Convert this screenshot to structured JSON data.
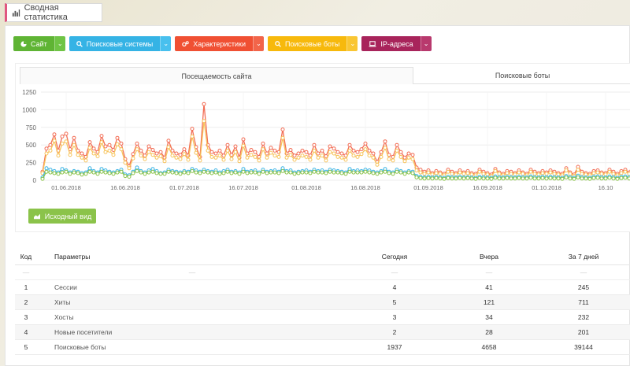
{
  "page": {
    "title": "Сводная статистика"
  },
  "toolbar": {
    "buttons": [
      {
        "label": "Сайт",
        "icon": "pie-chart-icon",
        "color": "#5fb434"
      },
      {
        "label": "Поисковые системы",
        "icon": "search-icon",
        "color": "#35b3e5"
      },
      {
        "label": "Характеристики",
        "icon": "gears-icon",
        "color": "#f05033"
      },
      {
        "label": "Поисковые боты",
        "icon": "search-icon",
        "color": "#f7b90c"
      },
      {
        "label": "IP-адреса",
        "icon": "laptop-icon",
        "color": "#a8245b"
      }
    ]
  },
  "chart": {
    "tabs": [
      "Посещаемость сайта",
      "Поисковые боты"
    ],
    "reset_label": "Исходный вид"
  },
  "chart_data": {
    "type": "line",
    "ylim": [
      0,
      1250
    ],
    "y_ticks": [
      "0",
      "250",
      "500",
      "750",
      "1000",
      "1250"
    ],
    "x_ticks": [
      "01.06.2018",
      "16.06.2018",
      "01.07.2018",
      "16.07.2018",
      "01.08.2018",
      "16.08.2018",
      "01.09.2018",
      "16.09.2018",
      "01.10.2018",
      "16.10"
    ],
    "x_tick_days": [
      6,
      21,
      36,
      51,
      67,
      82,
      98,
      113,
      128,
      143
    ],
    "series": [
      {
        "color": "#f26d55",
        "values": [
          120,
          450,
          500,
          650,
          420,
          620,
          660,
          440,
          600,
          420,
          380,
          330,
          540,
          450,
          400,
          630,
          480,
          500,
          430,
          600,
          520,
          300,
          200,
          370,
          520,
          420,
          350,
          480,
          430,
          380,
          400,
          320,
          560,
          420,
          380,
          360,
          440,
          350,
          730,
          470,
          330,
          1080,
          500,
          400,
          380,
          420,
          350,
          500,
          360,
          480,
          320,
          580,
          380,
          430,
          400,
          330,
          520,
          380,
          460,
          420,
          400,
          720,
          380,
          430,
          350,
          380,
          420,
          400,
          350,
          500,
          380,
          420,
          340,
          480,
          450,
          400,
          380,
          350,
          500,
          420,
          400,
          440,
          520,
          420,
          380,
          260,
          400,
          550,
          360,
          330,
          500,
          400,
          320,
          380,
          360,
          180,
          150,
          120,
          140,
          100,
          130,
          110,
          90,
          150,
          120,
          100,
          140,
          110,
          130,
          100,
          90,
          150,
          120,
          100,
          80,
          160,
          110,
          90,
          130,
          120,
          100,
          140,
          110,
          90,
          150,
          120,
          100,
          130,
          110,
          140,
          120,
          100,
          90,
          170,
          110,
          80,
          190,
          120,
          100,
          90,
          130,
          140,
          110,
          100,
          150,
          120,
          90,
          130,
          150,
          110,
          240
        ],
        "x_start": 0
      },
      {
        "color": "#f7c35a",
        "values": [
          100,
          380,
          420,
          560,
          350,
          520,
          550,
          360,
          500,
          360,
          320,
          280,
          460,
          380,
          340,
          540,
          400,
          420,
          360,
          510,
          440,
          250,
          170,
          310,
          440,
          350,
          300,
          400,
          360,
          320,
          340,
          270,
          470,
          350,
          320,
          300,
          370,
          290,
          620,
          390,
          280,
          840,
          420,
          330,
          320,
          350,
          290,
          420,
          300,
          400,
          270,
          490,
          320,
          360,
          330,
          280,
          440,
          320,
          390,
          350,
          330,
          600,
          320,
          360,
          290,
          320,
          350,
          330,
          290,
          420,
          320,
          350,
          280,
          400,
          380,
          330,
          320,
          290,
          420,
          350,
          330,
          370,
          440,
          350,
          320,
          220,
          330,
          460,
          300,
          280,
          420,
          330,
          270,
          320,
          300,
          140,
          110,
          90,
          110,
          80,
          100,
          90,
          70,
          120,
          90,
          80,
          110,
          90,
          100,
          80,
          70,
          120,
          90,
          80,
          60,
          130,
          90,
          70,
          100,
          90,
          80,
          110,
          90,
          70,
          120,
          90,
          80,
          100,
          90,
          110,
          90,
          80,
          70,
          140,
          90,
          60,
          150,
          90,
          80,
          70,
          100,
          110,
          90,
          80,
          120,
          90,
          70,
          100,
          120,
          90,
          180
        ],
        "x_start": 0
      },
      {
        "color": "#3fb5e5",
        "values": [
          40,
          170,
          150,
          130,
          110,
          160,
          140,
          110,
          130,
          120,
          100,
          110,
          170,
          130,
          110,
          160,
          140,
          120,
          110,
          130,
          150,
          80,
          70,
          120,
          180,
          130,
          110,
          140,
          160,
          130,
          100,
          110,
          150,
          130,
          120,
          110,
          130,
          120,
          160,
          140,
          120,
          150,
          130,
          120,
          140,
          110,
          130,
          150,
          120,
          130,
          110,
          160,
          120,
          130,
          140,
          110,
          150,
          120,
          130,
          140,
          120,
          170,
          130,
          140,
          110,
          120,
          130,
          140,
          120,
          150,
          130,
          140,
          120,
          150,
          140,
          130,
          120,
          110,
          160,
          130,
          140,
          130,
          150,
          140,
          120,
          110,
          130,
          160,
          120,
          110,
          150,
          130,
          110,
          130,
          120,
          60,
          50,
          40,
          50,
          40,
          50,
          40,
          35,
          50,
          45,
          40,
          50,
          40,
          45,
          40,
          35,
          50,
          45,
          40,
          35,
          55,
          45,
          40,
          50,
          45,
          40,
          50,
          45,
          40,
          55,
          45,
          40,
          50,
          45,
          50,
          45,
          40,
          35,
          60,
          45,
          35,
          65,
          45,
          40,
          35,
          50,
          55,
          45,
          40,
          55,
          45,
          35,
          50,
          55,
          45,
          70
        ],
        "x_start": 0
      },
      {
        "color": "#8bc34a",
        "values": [
          20,
          120,
          110,
          100,
          90,
          110,
          120,
          90,
          110,
          100,
          80,
          90,
          120,
          110,
          90,
          120,
          110,
          100,
          90,
          110,
          120,
          60,
          50,
          100,
          130,
          110,
          90,
          110,
          120,
          100,
          90,
          90,
          120,
          110,
          100,
          90,
          110,
          100,
          130,
          110,
          100,
          120,
          110,
          100,
          110,
          90,
          100,
          120,
          100,
          110,
          90,
          120,
          100,
          110,
          110,
          90,
          120,
          100,
          110,
          110,
          100,
          130,
          110,
          110,
          90,
          100,
          110,
          110,
          100,
          120,
          110,
          110,
          100,
          120,
          110,
          110,
          100,
          90,
          120,
          110,
          110,
          110,
          120,
          110,
          100,
          90,
          110,
          120,
          100,
          90,
          120,
          110,
          90,
          110,
          100,
          40,
          30,
          25,
          30,
          25,
          30,
          25,
          20,
          30,
          25,
          25,
          30,
          25,
          30,
          25,
          20,
          30,
          25,
          25,
          20,
          35,
          25,
          25,
          30,
          25,
          25,
          30,
          25,
          25,
          35,
          25,
          25,
          30,
          25,
          30,
          25,
          25,
          20,
          40,
          25,
          20,
          40,
          25,
          25,
          20,
          30,
          35,
          25,
          25,
          35,
          25,
          20,
          30,
          35,
          25,
          45
        ],
        "x_start": 0
      }
    ]
  },
  "table": {
    "headers": [
      "Код",
      "Параметры",
      "Сегодня",
      "Вчера",
      "За 7 дней"
    ],
    "dash": "—",
    "rows": [
      {
        "code": "1",
        "name": "Сессии",
        "today": "4",
        "yesterday": "41",
        "week": "245"
      },
      {
        "code": "2",
        "name": "Хиты",
        "today": "5",
        "yesterday": "121",
        "week": "711"
      },
      {
        "code": "3",
        "name": "Хосты",
        "today": "3",
        "yesterday": "34",
        "week": "232"
      },
      {
        "code": "4",
        "name": "Новые посетители",
        "today": "2",
        "yesterday": "28",
        "week": "201"
      },
      {
        "code": "5",
        "name": "Поисковые боты",
        "today": "1937",
        "yesterday": "4658",
        "week": "39144"
      }
    ]
  }
}
